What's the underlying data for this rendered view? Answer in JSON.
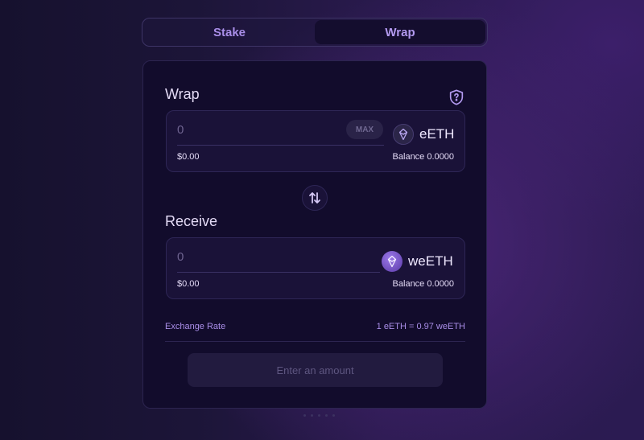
{
  "tabs": [
    {
      "label": "Stake",
      "active": false
    },
    {
      "label": "Wrap",
      "active": true
    }
  ],
  "wrap_section": {
    "title": "Wrap",
    "input": {
      "value": "",
      "placeholder": "0"
    },
    "max_label": "MAX",
    "token": {
      "symbol": "eETH",
      "icon": "eeth-icon"
    },
    "usd_value": "$0.00",
    "balance": "Balance 0.0000"
  },
  "swap_icon": "swap-arrows-icon",
  "help_icon": "shield-question-icon",
  "receive_section": {
    "title": "Receive",
    "input": {
      "value": "",
      "placeholder": "0"
    },
    "token": {
      "symbol": "weETH",
      "icon": "weeth-icon"
    },
    "usd_value": "$0.00",
    "balance": "Balance 0.0000"
  },
  "exchange_rate": {
    "label": "Exchange Rate",
    "value": "1 eETH = 0.97 weETH"
  },
  "submit_button": {
    "label": "Enter an amount",
    "disabled": true
  },
  "colors": {
    "accent": "#a98ee8",
    "card_bg": "#120c2c",
    "input_bg": "#1a1238"
  }
}
